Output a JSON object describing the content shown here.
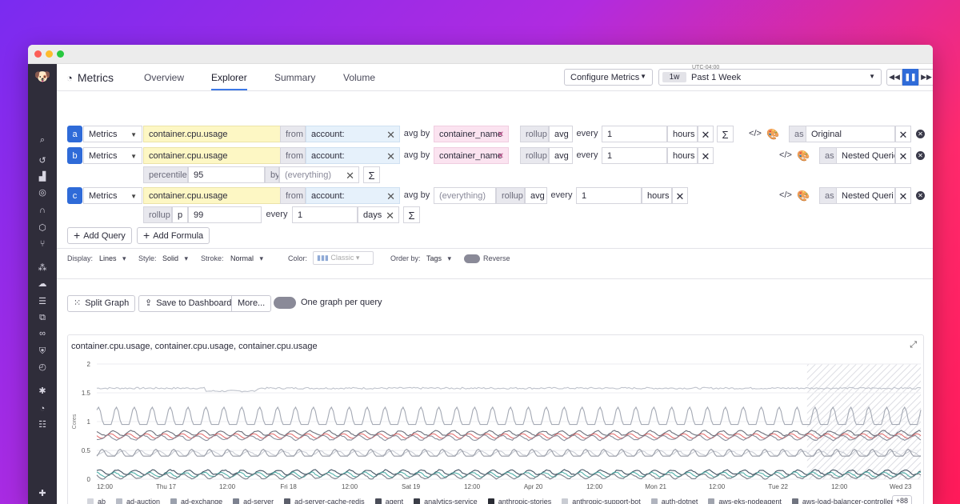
{
  "app": {
    "title": "Metrics",
    "tabs": [
      {
        "label": "Overview"
      },
      {
        "label": "Explorer",
        "active": true
      },
      {
        "label": "Summary"
      },
      {
        "label": "Volume"
      }
    ],
    "configure_metrics": "Configure Metrics",
    "timezone": "UTC-04:00",
    "time_chip": "1w",
    "time_label": "Past 1 Week"
  },
  "queries": [
    {
      "letter": "a",
      "source": "Metrics",
      "metric": "container.cpu.usage",
      "from_label": "from",
      "from_value": "account:",
      "avg_by_label": "avg by",
      "avg_by_value": "container_name",
      "rollup_label": "rollup",
      "rollup_fn": "avg",
      "every_label": "every",
      "every_value": "1",
      "unit": "hours",
      "alias_label": "as",
      "alias": "Original"
    },
    {
      "letter": "b",
      "source": "Metrics",
      "metric": "container.cpu.usage",
      "from_label": "from",
      "from_value": "account:",
      "avg_by_label": "avg by",
      "avg_by_value": "container_name",
      "rollup_label": "rollup",
      "rollup_fn": "avg",
      "every_label": "every",
      "every_value": "1",
      "unit": "hours",
      "alias_label": "as",
      "alias": "Nested Querie",
      "sub": {
        "fn": "percentile",
        "value": "95",
        "by_label": "by",
        "by_placeholder": "(everything)"
      }
    },
    {
      "letter": "c",
      "source": "Metrics",
      "metric": "container.cpu.usage",
      "from_label": "from",
      "from_value": "account:",
      "avg_by_label": "avg by",
      "avg_by_placeholder": "(everything)",
      "rollup_label": "rollup",
      "rollup_fn": "avg",
      "every_label": "every",
      "every_value": "1",
      "unit": "hours",
      "alias_label": "as",
      "alias": "Nested Queri",
      "sub": {
        "rollup_label": "rollup",
        "fn": "p",
        "value": "99",
        "every_label": "every",
        "every_value": "1",
        "unit": "days"
      }
    }
  ],
  "actions": {
    "add_query": "Add Query",
    "add_formula": "Add Formula"
  },
  "display_options": {
    "display_label": "Display:",
    "display_value": "Lines",
    "style_label": "Style:",
    "style_value": "Solid",
    "stroke_label": "Stroke:",
    "stroke_value": "Normal",
    "color_label": "Color:",
    "color_value": "Classic",
    "order_label": "Order by:",
    "order_value": "Tags",
    "reverse_label": "Reverse"
  },
  "graph_toolbar": {
    "split_graph": "Split Graph",
    "save_to_dashboard": "Save to Dashboard",
    "more": "More...",
    "one_graph_per_query": "One graph per query"
  },
  "chart_data": {
    "type": "line",
    "title": "container.cpu.usage, container.cpu.usage, container.cpu.usage",
    "ylabel": "Cores",
    "ylim": [
      0,
      2
    ],
    "y_ticks": [
      "0",
      "0.5",
      "1",
      "1.5",
      "2"
    ],
    "x_ticks": [
      "12:00",
      "Thu 17",
      "12:00",
      "Fri 18",
      "12:00",
      "Sat 19",
      "12:00",
      "Apr 20",
      "12:00",
      "Mon 21",
      "12:00",
      "Tue 22",
      "12:00",
      "Wed 23"
    ],
    "series_levels": [
      1.58,
      1.0,
      0.8,
      0.75,
      0.72,
      0.45,
      0.4,
      0.12,
      0.08,
      0.05
    ],
    "series_colors": [
      "#b8bcc6",
      "#9aa0ac",
      "#5c5f6b",
      "#e05555",
      "#7d8290",
      "#c4c8d0",
      "#8f939e",
      "#2c3e50",
      "#3fa7a0",
      "#6b6f7a"
    ],
    "legend": [
      {
        "name": "ab",
        "color": "#d3d5dc"
      },
      {
        "name": "ad-auction",
        "color": "#b8bcc6"
      },
      {
        "name": "ad-exchange",
        "color": "#9aa0ac"
      },
      {
        "name": "ad-server",
        "color": "#7d8290"
      },
      {
        "name": "ad-server-cache-redis",
        "color": "#5c5f6b"
      },
      {
        "name": "agent",
        "color": "#4a4d58"
      },
      {
        "name": "analytics-service",
        "color": "#3a3d47"
      },
      {
        "name": "anthropic-stories",
        "color": "#2a2c34"
      },
      {
        "name": "anthropic-support-bot",
        "color": "#c9ccd3"
      },
      {
        "name": "auth-dotnet",
        "color": "#b0b4be"
      },
      {
        "name": "aws-eks-nodeagent",
        "color": "#a0a4ae"
      },
      {
        "name": "aws-load-balancer-controller",
        "color": "#707480"
      }
    ],
    "more_count": "+88"
  }
}
